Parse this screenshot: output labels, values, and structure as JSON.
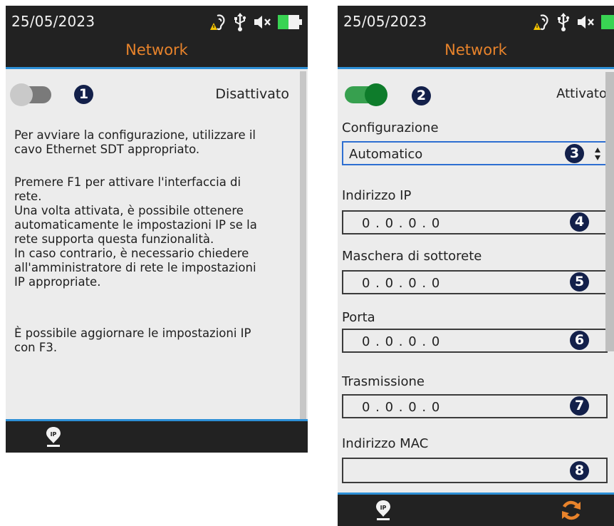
{
  "screen1": {
    "date": "25/05/2023",
    "title": "Network",
    "toggle_badge": "1",
    "status": "Disattivato",
    "paragraphs": [
      [
        "Per avviare la configurazione, utilizzare il",
        "cavo Ethernet SDT appropriato."
      ],
      [
        "Premere F1 per attivare l'interfaccia di",
        "rete.",
        "Una volta attivata, è possibile ottenere",
        "automaticamente le impostazioni IP se la",
        "rete supporta questa funzionalità.",
        "In caso contrario, è necessario chiedere",
        "all'amministratore di rete le impostazioni",
        "IP appropriate."
      ],
      [
        "È possibile aggiornare le impostazioni IP",
        "con F3."
      ]
    ]
  },
  "screen2": {
    "date": "25/05/2023",
    "title": "Network",
    "toggle_badge": "2",
    "status": "Attivato",
    "config_label": "Configurazione",
    "config_value": "Automatico",
    "config_badge": "3",
    "fields": [
      {
        "label": "Indirizzo IP",
        "value": "0 . 0 . 0 . 0",
        "badge": "4"
      },
      {
        "label": "Maschera di sottorete",
        "value": "0 . 0 . 0 . 0",
        "badge": "5"
      },
      {
        "label": "Porta",
        "value": "0 . 0 . 0 . 0",
        "badge": "6"
      },
      {
        "label": "Trasmissione",
        "value": "0 . 0 . 0 . 0",
        "badge": "7"
      },
      {
        "label": "Indirizzo MAC",
        "value": "",
        "badge": "8"
      }
    ]
  },
  "icons": [
    "hearing-warning-icon",
    "usb-icon",
    "speaker-muted-icon",
    "battery-icon",
    "ip-location-icon",
    "refresh-icon"
  ],
  "colors": {
    "title": "#e8832b",
    "accent_line": "#2d8fd6",
    "toggle_on": "#1a9c3b",
    "badge": "#13204a",
    "battery": "#39d353",
    "select_border": "#2e6fd1"
  }
}
